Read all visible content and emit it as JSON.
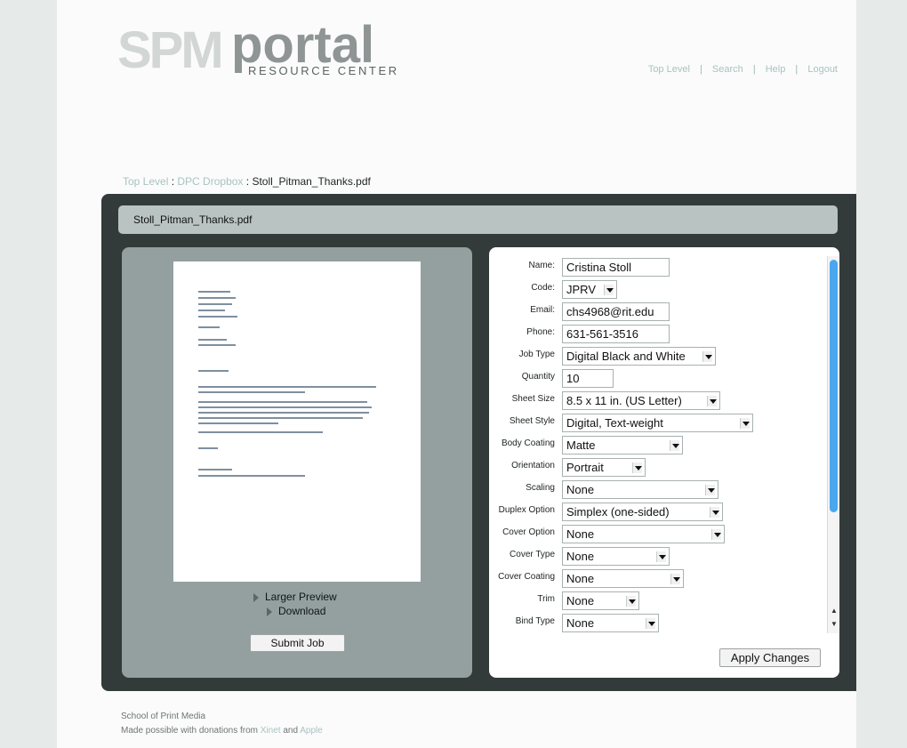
{
  "logo": {
    "spm": "SPM",
    "portal": "portal",
    "tagline": "RESOURCE CENTER"
  },
  "topnav": {
    "items": [
      "Top Level",
      "Search",
      "Help",
      "Logout"
    ],
    "separator": "|"
  },
  "breadcrumb": {
    "level1": "Top Level",
    "sep1": " : ",
    "level2": "DPC Dropbox",
    "sep2": " : ",
    "current": "Stoll_Pitman_Thanks.pdf"
  },
  "panel_title": "Stoll_Pitman_Thanks.pdf",
  "preview": {
    "larger_preview": "Larger Preview",
    "download": "Download",
    "submit": "Submit Job"
  },
  "form": {
    "name": {
      "label": "Name:",
      "value": "Cristina Stoll"
    },
    "code": {
      "label": "Code:",
      "value": "JPRV"
    },
    "email": {
      "label": "Email:",
      "value": "chs4968@rit.edu"
    },
    "phone": {
      "label": "Phone:",
      "value": "631-561-3516"
    },
    "job_type": {
      "label": "Job Type",
      "value": "Digital Black and White"
    },
    "quantity": {
      "label": "Quantity",
      "value": "10"
    },
    "sheet_size": {
      "label": "Sheet Size",
      "value": "8.5 x 11 in. (US Letter)"
    },
    "sheet_style": {
      "label": "Sheet Style",
      "value": "Digital, Text-weight"
    },
    "body_coating": {
      "label": "Body Coating",
      "value": "Matte"
    },
    "orientation": {
      "label": "Orientation",
      "value": "Portrait"
    },
    "scaling": {
      "label": "Scaling",
      "value": "None"
    },
    "duplex_option": {
      "label": "Duplex Option",
      "value": "Simplex (one-sided)"
    },
    "cover_option": {
      "label": "Cover Option",
      "value": "None"
    },
    "cover_type": {
      "label": "Cover Type",
      "value": "None"
    },
    "cover_coating": {
      "label": "Cover Coating",
      "value": "None"
    },
    "trim": {
      "label": "Trim",
      "value": "None"
    },
    "bind_type": {
      "label": "Bind Type",
      "value": "None"
    }
  },
  "apply_button": "Apply Changes",
  "footer": {
    "line1": "School of Print Media",
    "line2_prefix": "Made possible with donations from ",
    "sponsor1": "Xinet",
    "and": " and ",
    "sponsor2": "Apple"
  },
  "colors": {
    "panel_dark": "#333b3a",
    "panel_grey": "#93a09f",
    "scroll_thumb": "#4aa7ee",
    "link": "#a9c3c0"
  }
}
